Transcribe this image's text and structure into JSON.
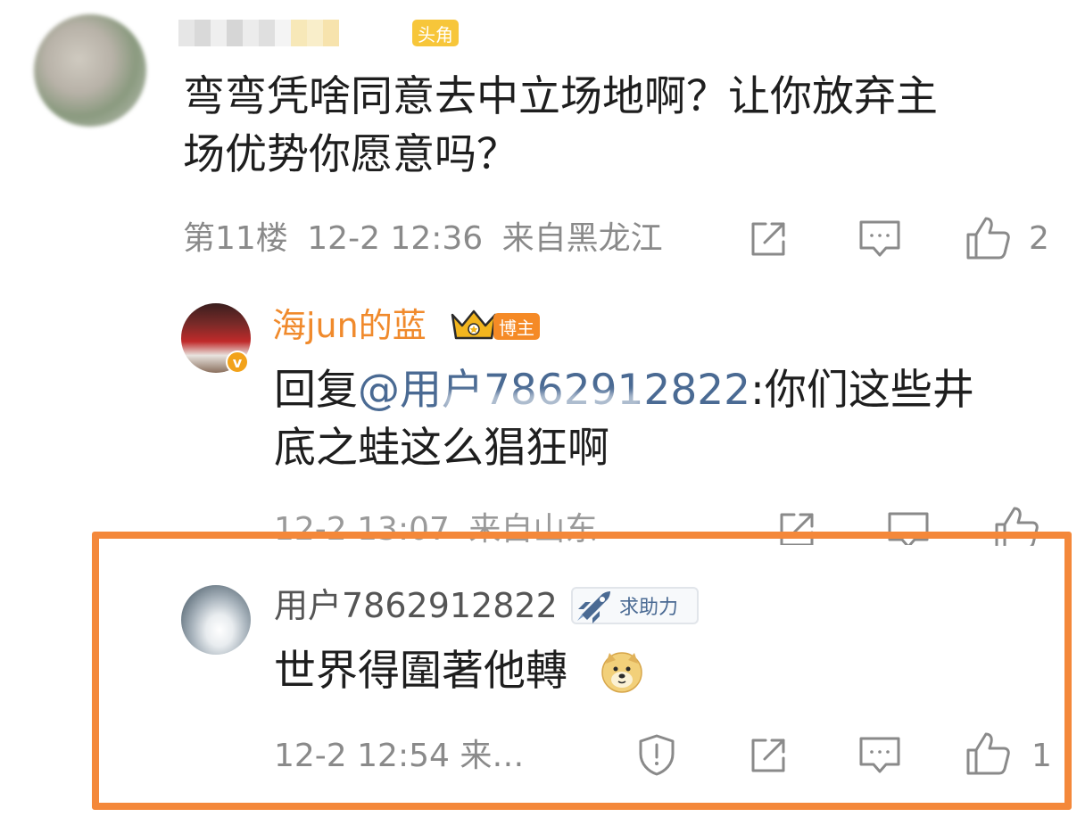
{
  "comments": [
    {
      "badge": "头角",
      "text_line1": "弯弯凭啥同意去中立场地啊？让你放弃主",
      "text_line2": "场优势你愿意吗？",
      "floor": "第11楼",
      "time": "12-2 12:36",
      "location": "来自黑龙江",
      "like_count": "2"
    },
    {
      "username": "海jun的蓝",
      "badge": "博主",
      "reply_prefix": "回复",
      "mention": "@用户7862912822",
      "text_line1_rest": ":你们这些井",
      "text_line2": "底之蛙这么猖狂啊",
      "time": "12-2 13:07",
      "location": "来自山东"
    },
    {
      "username": "用户7862912822",
      "badge": "求助力",
      "text": "世界得圍著他轉",
      "time_location": "12-2 12:54 来…",
      "like_count": "1"
    }
  ],
  "colors": {
    "highlight_border": "#f4883a",
    "blogger_name": "#f08a2c",
    "mention": "#4a6a93",
    "meta_gray": "#8a8a8a"
  },
  "icons": [
    "report-icon",
    "share-icon",
    "comment-icon",
    "like-icon",
    "crown-icon",
    "rocket-icon",
    "doge-emoji-icon",
    "verified-icon"
  ]
}
